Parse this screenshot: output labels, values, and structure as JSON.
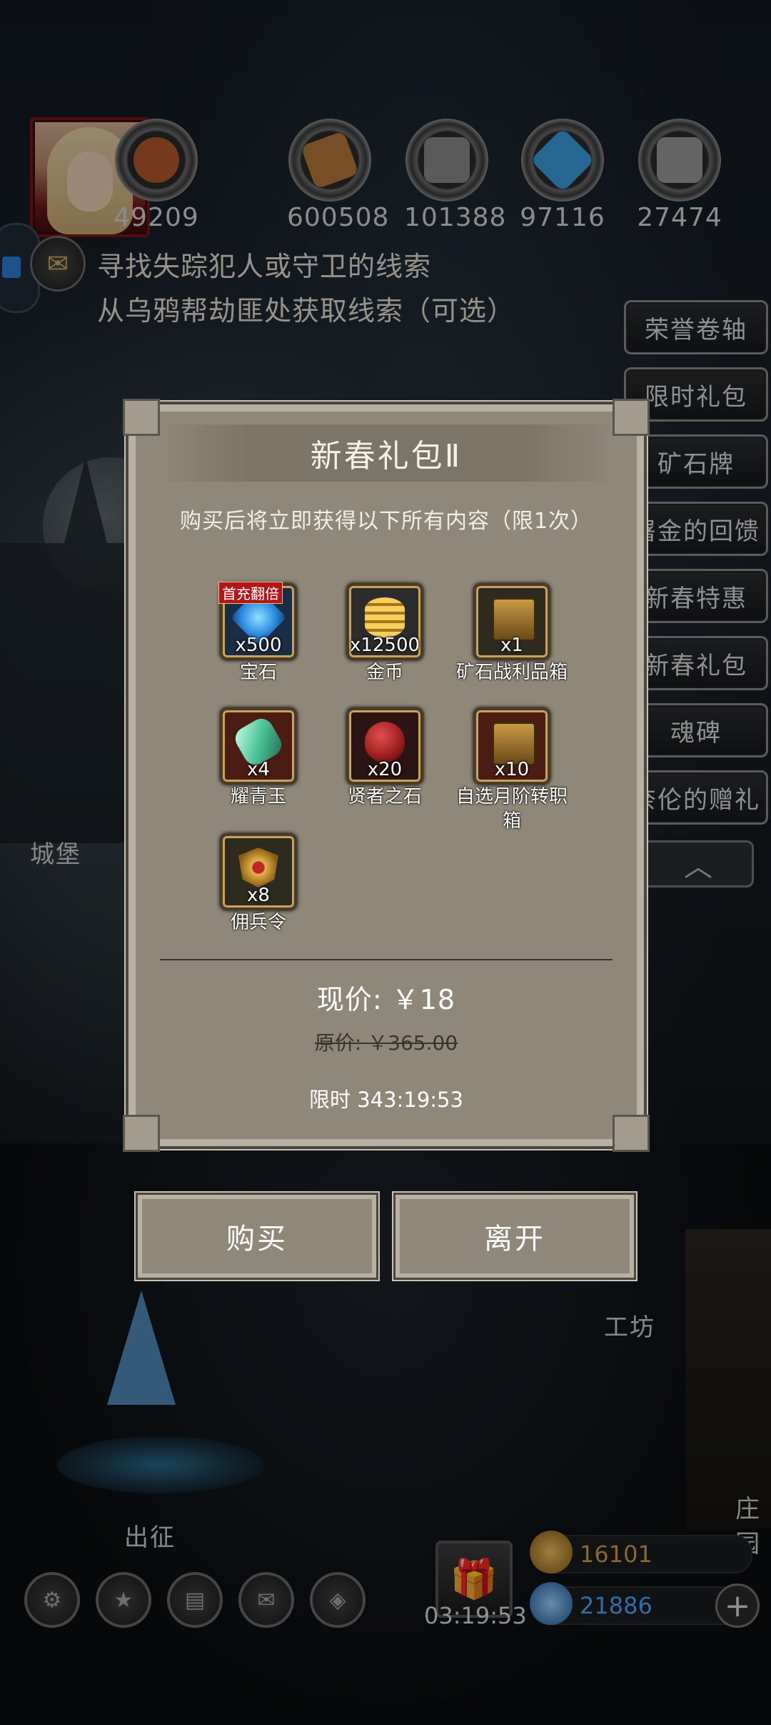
{
  "resources": [
    {
      "icon": "meat-icon",
      "value": "49209",
      "color": "#b5582b"
    },
    {
      "icon": "wood-icon",
      "value": "600508",
      "color": "#b8793a"
    },
    {
      "icon": "iron-icon",
      "value": "101388",
      "color": "#8a8a8a"
    },
    {
      "icon": "crystal-icon",
      "value": "97116",
      "color": "#3ca0e0"
    },
    {
      "icon": "stone-icon",
      "value": "27474",
      "color": "#9a9a9a"
    }
  ],
  "quest": {
    "line1": "寻找失踪犯人或守卫的线索",
    "line2": "从乌鸦帮劫匪处获取线索（可选）"
  },
  "right_menu": [
    "荣誉卷轴",
    "限时礼包",
    "矿石牌",
    "屠金的回馈",
    "新春特惠",
    "新春礼包",
    "魂碑",
    "奈伦的赠礼"
  ],
  "map_labels": {
    "castle": "城堡",
    "workshop": "工坊",
    "expedition": "出征",
    "manor": "庄园"
  },
  "dialog": {
    "title": "新春礼包Ⅱ",
    "subtitle": "购买后将立即获得以下所有内容（限1次）",
    "items": [
      {
        "name": "宝石",
        "qty": "x500",
        "tag": "首充翻倍",
        "icon": "gem-icon",
        "color": "#2d8ce0"
      },
      {
        "name": "金币",
        "qty": "x12500",
        "icon": "gold-coin-icon",
        "color": "#d6a72a"
      },
      {
        "name": "矿石战利品箱",
        "qty": "x1",
        "icon": "chest-icon",
        "color": "#b98a3a"
      },
      {
        "name": "耀青玉",
        "qty": "x4",
        "icon": "jade-icon",
        "color": "#4fc69a"
      },
      {
        "name": "贤者之石",
        "qty": "x20",
        "icon": "sage-stone-icon",
        "color": "#a42020"
      },
      {
        "name": "自选月阶转职箱",
        "qty": "x10",
        "icon": "chest-icon",
        "color": "#b98a3a"
      },
      {
        "name": "佣兵令",
        "qty": "x8",
        "icon": "mercenary-badge-icon",
        "color": "#d19b2b"
      }
    ],
    "price_now": "现价: ￥18",
    "price_old": "原价: ￥365.00",
    "timer": "限时 343:19:53"
  },
  "buttons": {
    "buy": "购买",
    "leave": "离开"
  },
  "bottom": {
    "gift_timer": "03:19:53",
    "gold": "16101",
    "gems": "21886",
    "gold_color": "#d6a040",
    "gem_color": "#4da6ff"
  }
}
